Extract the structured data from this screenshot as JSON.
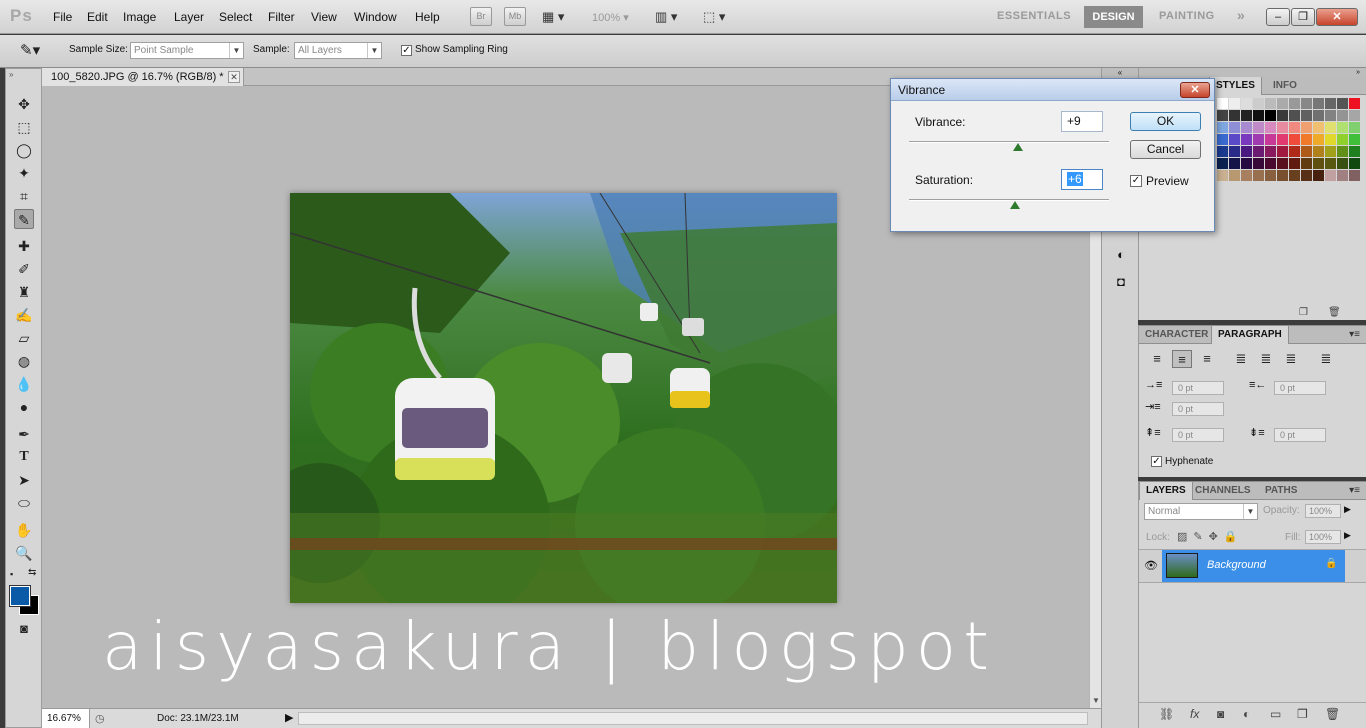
{
  "app": {
    "logo": "Ps",
    "menus": [
      "File",
      "Edit",
      "Image",
      "Layer",
      "Select",
      "Filter",
      "View",
      "Window",
      "Help"
    ],
    "bridge_label": "Br",
    "minibridge_label": "Mb",
    "zoom_menu": "100%",
    "workspaces": [
      "ESSENTIALS",
      "DESIGN",
      "PAINTING"
    ],
    "more_workspaces": "»",
    "window_buttons": [
      "–",
      "❐",
      "✕"
    ]
  },
  "options": {
    "sample_size_label": "Sample Size:",
    "sample_size_value": "Point Sample",
    "sample_label": "Sample:",
    "sample_value": "All Layers",
    "show_ring_label": "Show Sampling Ring",
    "show_ring_checked": true
  },
  "document": {
    "tab_title": "100_5820.JPG @ 16.7% (RGB/8) *",
    "tab_close": "✕",
    "zoom": "16.67%",
    "doc_info": "Doc: 23.1M/23.1M"
  },
  "watermark": "aisyasakura | blogspot",
  "dialog": {
    "title": "Vibrance",
    "close": "✕",
    "vibrance_label": "Vibrance:",
    "vibrance_value": "+9",
    "saturation_label": "Saturation:",
    "saturation_value": "+6",
    "ok_label": "OK",
    "cancel_label": "Cancel",
    "preview_label": "Preview",
    "preview_checked": true
  },
  "swatches_panel": {
    "tabs": [
      "STYLES",
      "INFO"
    ]
  },
  "text_panel": {
    "tabs": [
      "CHARACTER",
      "PARAGRAPH"
    ],
    "indent_left": "0 pt",
    "indent_right": "0 pt",
    "indent_first": "0 pt",
    "space_before": "0 pt",
    "space_after": "0 pt",
    "hyphenate_label": "Hyphenate",
    "hyphenate_checked": true
  },
  "layers_panel": {
    "tabs": [
      "LAYERS",
      "CHANNELS",
      "PATHS"
    ],
    "blend_mode": "Normal",
    "opacity_label": "Opacity:",
    "opacity_value": "100%",
    "lock_label": "Lock:",
    "fill_label": "Fill:",
    "fill_value": "100%",
    "layers": [
      {
        "name": "Background",
        "locked": true,
        "visible": true
      }
    ],
    "footer_icons": [
      "link-icon",
      "fx-icon",
      "mask-icon",
      "adjustment-icon",
      "group-icon",
      "new-layer-icon",
      "trash-icon"
    ]
  },
  "colors": {
    "foreground": "#0a5aa8",
    "background": "#000000",
    "selected_layer": "#3c8fe8"
  }
}
